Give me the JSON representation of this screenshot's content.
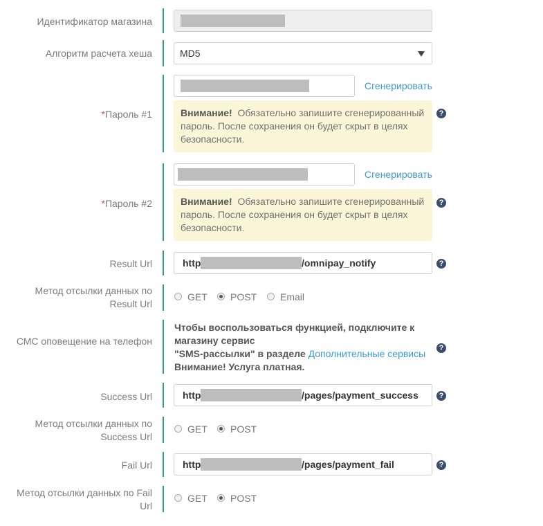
{
  "shop_id": {
    "label": "Идентификатор магазина"
  },
  "hash_algo": {
    "label": "Алгоритм расчета хеша",
    "value": "MD5"
  },
  "password1": {
    "required_mark": "*",
    "label": "Пароль #1",
    "generate": "Сгенерировать",
    "warning_title": "Внимание!",
    "warning_text": "Обязательно запишите сгенерированный пароль. После сохранения он будет скрыт в целях безопасности."
  },
  "password2": {
    "required_mark": "*",
    "label": "Пароль #2",
    "generate": "Сгенерировать",
    "warning_title": "Внимание!",
    "warning_text": "Обязательно запишите сгенерированный пароль. После сохранения он будет скрыт в целях безопасности."
  },
  "result_url": {
    "label": "Result Url",
    "prefix": "http",
    "suffix": "/omnipay_notify"
  },
  "result_method": {
    "label": "Метод отсылки данных по Result Url",
    "options": [
      "GET",
      "POST",
      "Email"
    ],
    "selected": "POST"
  },
  "sms": {
    "label": "СМС оповещение на телефон",
    "line1": "Чтобы воспользоваться функцией, подключите к магазину сервис",
    "line2": "\"SMS-рассылки\" в разделе",
    "link": "Дополнительные сервисы",
    "line3": "Внимание! Услуга платная."
  },
  "success_url": {
    "label": "Success Url",
    "prefix": "http",
    "suffix": "/pages/payment_success"
  },
  "success_method": {
    "label": "Метод отсылки данных по Success Url",
    "options": [
      "GET",
      "POST"
    ],
    "selected": "POST"
  },
  "fail_url": {
    "label": "Fail Url",
    "prefix": "http",
    "suffix": "/pages/payment_fail"
  },
  "fail_method": {
    "label": "Метод отсылки данных по Fail Url",
    "options": [
      "GET",
      "POST"
    ],
    "selected": "POST"
  },
  "help_glyph": "?"
}
